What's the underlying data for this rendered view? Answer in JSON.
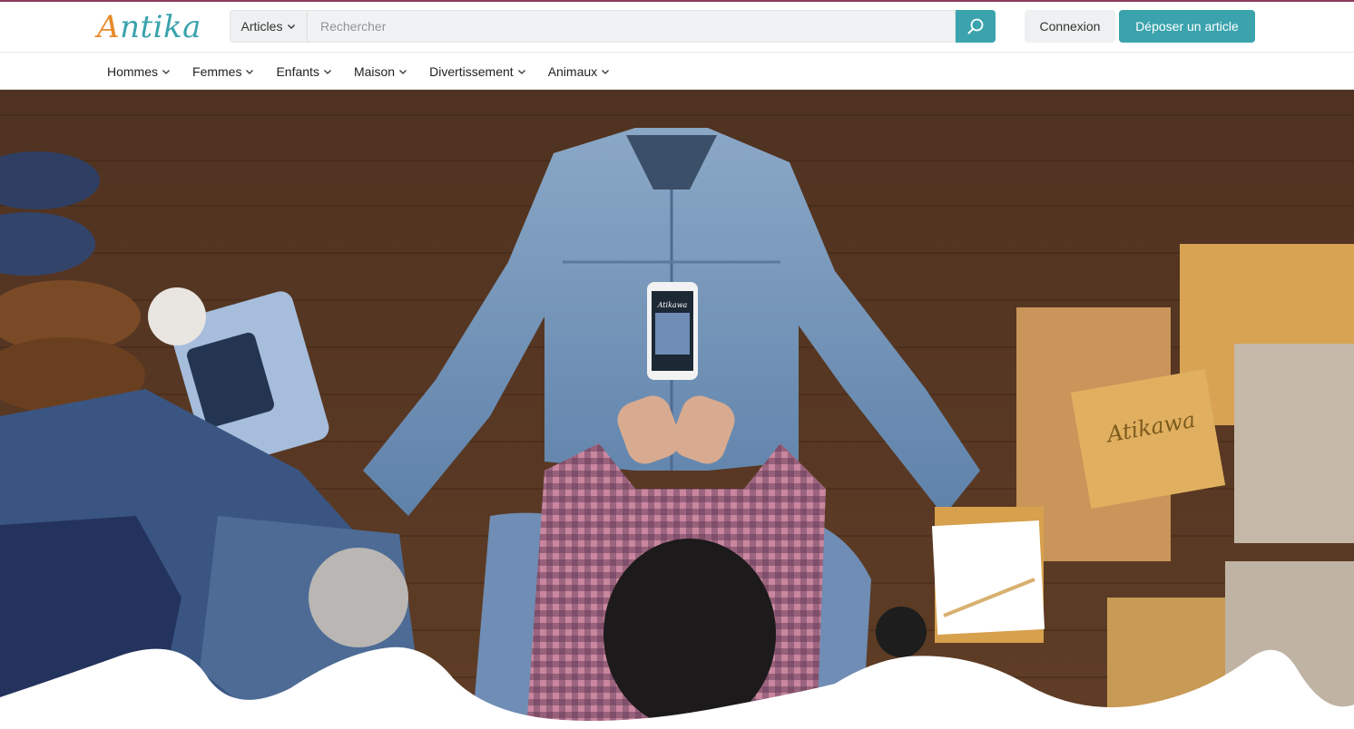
{
  "brand": {
    "logo_first": "A",
    "logo_rest": "ntika"
  },
  "search": {
    "category": "Articles",
    "placeholder": "Rechercher"
  },
  "header": {
    "login_label": "Connexion",
    "post_label": "Déposer un article"
  },
  "nav": {
    "items": [
      {
        "label": "Hommes"
      },
      {
        "label": "Femmes"
      },
      {
        "label": "Enfants"
      },
      {
        "label": "Maison"
      },
      {
        "label": "Divertissement"
      },
      {
        "label": "Animaux"
      }
    ]
  },
  "hero": {
    "box_label": "Atikawa",
    "phone_label": "Atikawa"
  },
  "colors": {
    "accent": "#3ba3ad",
    "logo_orange": "#e88a2a",
    "topline": "#8a3a5a",
    "floor": "#5b3a24",
    "denim": "#6f8fb3"
  },
  "icons": {
    "search": "magnifier-icon",
    "chevron": "chevron-down-icon"
  }
}
